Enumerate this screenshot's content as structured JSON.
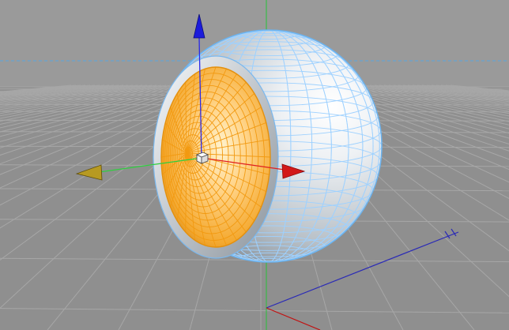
{
  "viewport": {
    "view": "perspective",
    "grid_visible": true,
    "selected_object": "hemisphere-cavity",
    "colors": {
      "background": "#8f8f8f",
      "grid_line": "#a3a3a3",
      "horizon_guide": "#5aa7de",
      "world_axis_x": "#c21111",
      "world_axis_y": "#27c23a",
      "world_axis_z": "#2b2bb6",
      "wireframe": "#8ec8ff",
      "selection_highlight": "#f3a41d",
      "sphere_shell": "#cfd6dd"
    }
  },
  "gizmo": {
    "type": "move",
    "handles": [
      {
        "axis": "x",
        "icon": "red-arrow-icon",
        "color": "#d21818"
      },
      {
        "axis": "y",
        "icon": "blue-arrow-icon",
        "color": "#1c1cdc"
      },
      {
        "axis": "z",
        "icon": "yellow-arrow-icon",
        "color": "#b79a22"
      }
    ],
    "center_icon": "cube-pivot-icon"
  }
}
